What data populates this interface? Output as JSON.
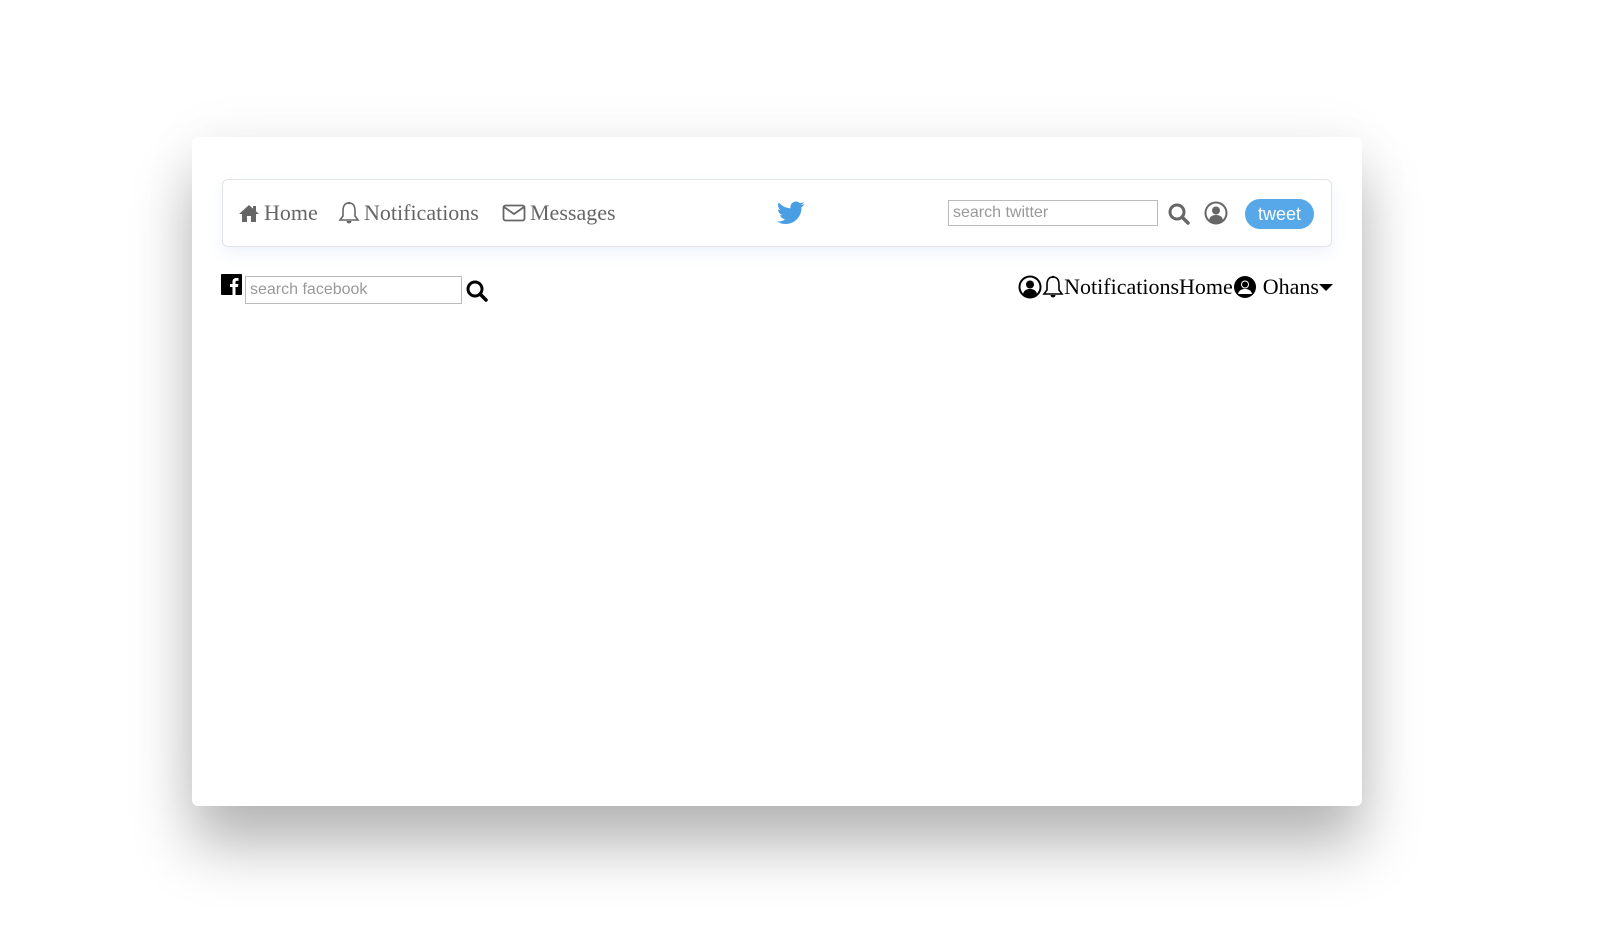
{
  "twitter_nav": {
    "items": [
      {
        "label": "Home",
        "icon": "home-icon"
      },
      {
        "label": "Notifications",
        "icon": "bell-icon"
      },
      {
        "label": "Messages",
        "icon": "envelope-icon"
      }
    ],
    "logo": "twitter-bird-icon",
    "search_placeholder": "search twitter",
    "tweet_label": "tweet",
    "accent_color": "#56a8e8"
  },
  "facebook_nav": {
    "logo": "facebook-icon",
    "search_placeholder": "search facebook",
    "notifications_label": "Notifications",
    "home_label": "Home",
    "user_name": "Ohans"
  }
}
